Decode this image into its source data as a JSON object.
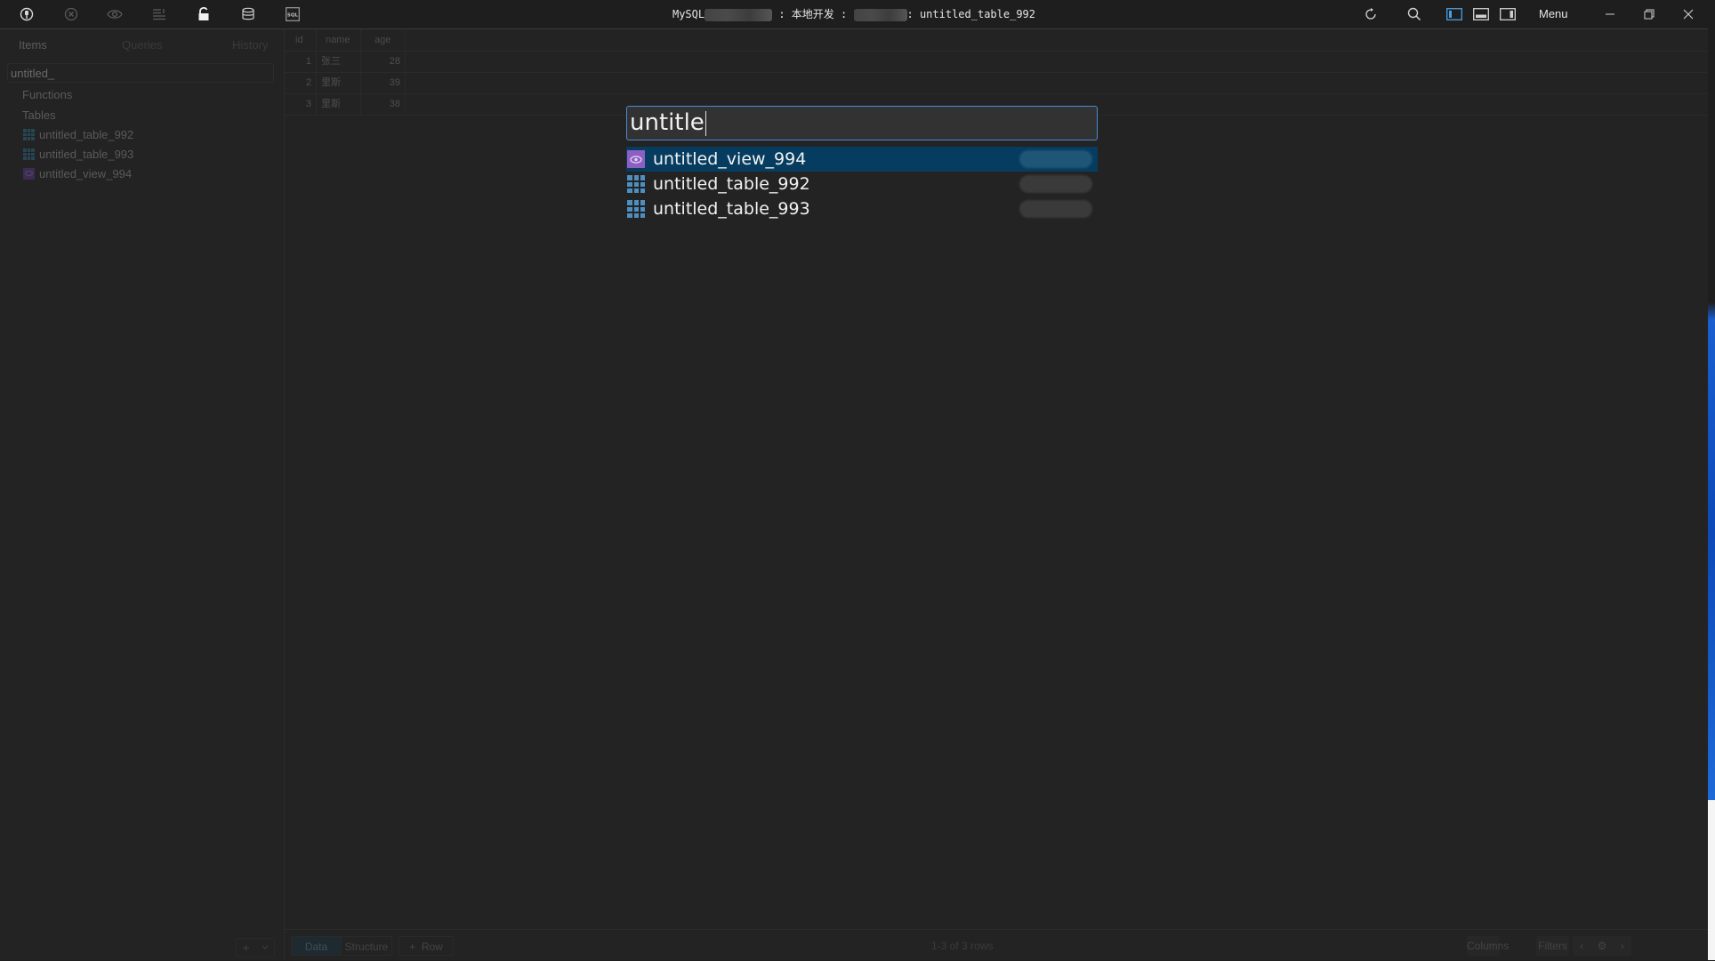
{
  "titlebar": {
    "title_prefix": "MySQL",
    "separator1": " : ",
    "connection_name": "本地开发",
    "separator2": " : ",
    "separator3": ": ",
    "table_name": "untitled_table_992",
    "menu_label": "Menu",
    "left_icons": [
      "connection-icon",
      "close-connection-icon",
      "preview-icon",
      "sql-import-icon",
      "lock-icon",
      "database-icon",
      "sql-icon"
    ],
    "right_icons": [
      "reload-icon",
      "search-icon",
      "toggle-left-panel-icon",
      "toggle-bottom-panel-icon",
      "toggle-right-panel-icon"
    ],
    "window_controls": [
      "minimize",
      "restore",
      "close"
    ],
    "accent_color": "#4a9ee0"
  },
  "sidebar": {
    "tabs": [
      {
        "label": "Items",
        "active": true
      },
      {
        "label": "Queries",
        "active": false
      },
      {
        "label": "History",
        "active": false
      }
    ],
    "search_value": "untitled_",
    "sections": [
      {
        "label": "Functions"
      },
      {
        "label": "Tables"
      }
    ],
    "items": [
      {
        "label": "untitled_table_992",
        "type": "table"
      },
      {
        "label": "untitled_table_993",
        "type": "table"
      },
      {
        "label": "untitled_view_994",
        "type": "view"
      }
    ],
    "add_button_label": "+"
  },
  "grid": {
    "columns": [
      "id",
      "name",
      "age"
    ],
    "rows": [
      {
        "id": "1",
        "name": "张三",
        "age": "28"
      },
      {
        "id": "2",
        "name": "里斯",
        "age": "39"
      },
      {
        "id": "3",
        "name": "里斯",
        "age": "38"
      }
    ]
  },
  "bottom_bar": {
    "tab_data": "Data",
    "tab_structure": "Structure",
    "add_row_label": "Row",
    "status": "1-3 of 3 rows",
    "columns_label": "Columns",
    "filters_label": "Filters"
  },
  "quick_open": {
    "input_value": "untitle",
    "results": [
      {
        "label": "untitled_view_994",
        "type": "view",
        "selected": true
      },
      {
        "label": "untitled_table_992",
        "type": "table",
        "selected": false
      },
      {
        "label": "untitled_table_993",
        "type": "table",
        "selected": false
      }
    ],
    "selected_color": "#063c5f",
    "view_icon_color": "#8d5fc3",
    "table_icon_color": "#4d8fc0"
  }
}
